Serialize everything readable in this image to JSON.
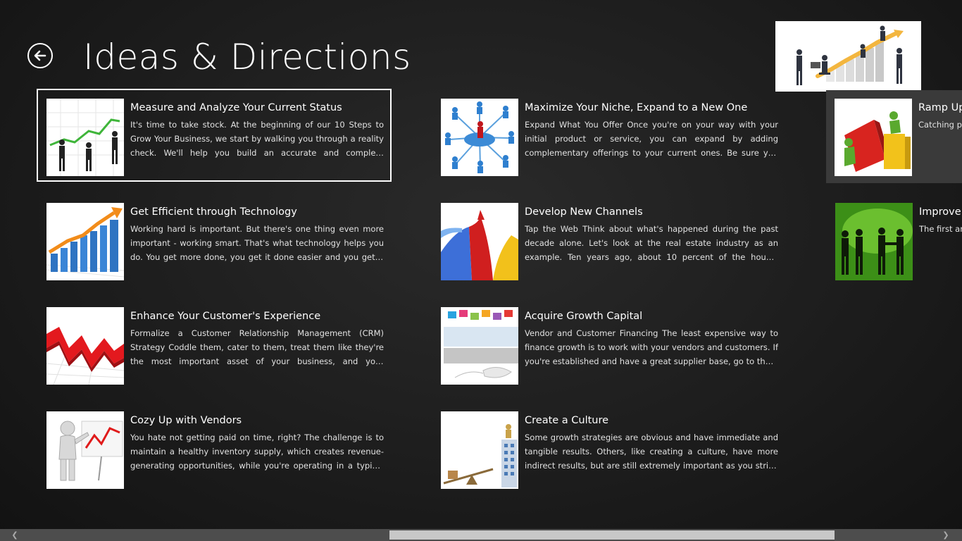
{
  "header": {
    "title": "Ideas & Directions"
  },
  "items": [
    {
      "title": "Measure and Analyze Your Current Status",
      "desc": "It's time to take stock. At the beginning of our 10 Steps to Grow Your Business, we start by walking you through a reality check. We'll help you build an accurate and complete understanding of your current business situation.",
      "image": "rising-arrow-team-image"
    },
    {
      "title": "Get Efficient through Technology",
      "desc": "Working hard is important. But there's one thing even more important - working smart. That's what technology helps you do. You get more done, you get it done easier and you get it done faster.",
      "image": "bar-chart-arrow-image"
    },
    {
      "title": "Enhance Your Customer's Experience",
      "desc": "Formalize a Customer Relationship Management (CRM) Strategy Coddle them, cater to them, treat them like they're the most important asset of your business, and your customers will grow with you.",
      "image": "red-zigzag-arrow-image"
    },
    {
      "title": "Cozy Up with Vendors",
      "desc": "You hate not getting paid on time, right? The challenge is to maintain a healthy inventory supply, which creates revenue-generating opportunities, while you're operating in a typical cash cycle.",
      "image": "presenter-chart-image"
    },
    {
      "title": "Maximize Your Niche, Expand to a New One",
      "desc": "Expand What You Offer Once you're on your way with your initial product or service, you can expand by adding complementary offerings to your current ones. Be sure you have crisp and credible messaging.",
      "image": "network-people-image"
    },
    {
      "title": "Develop New Channels",
      "desc": "Tap the Web Think about what's happened during the past decade alone. Let's look at the real estate industry as an example. Ten years ago, about 10 percent of the house-buying public was going online.",
      "image": "colored-arrows-image"
    },
    {
      "title": "Acquire Growth Capital",
      "desc": "Vendor and Customer Financing The least expensive way to finance growth is to work with your vendors and customers. If you're established and have a great supplier base, go to them and ask for terms.",
      "image": "social-media-image"
    },
    {
      "title": "Create a Culture",
      "desc": "Some growth strategies are obvious and have immediate and tangible results. Others, like creating a culture, have more indirect results, but are still extremely important as you strive to make your business grow.",
      "image": "seesaw-building-image"
    },
    {
      "title": "Ramp Up",
      "desc": "Catching people's attention to make sometimes promotions",
      "image": "puzzle-blocks-image"
    },
    {
      "title": "Improve S",
      "desc": "The first and sales results seems obvious",
      "image": "green-handshake-image"
    }
  ]
}
